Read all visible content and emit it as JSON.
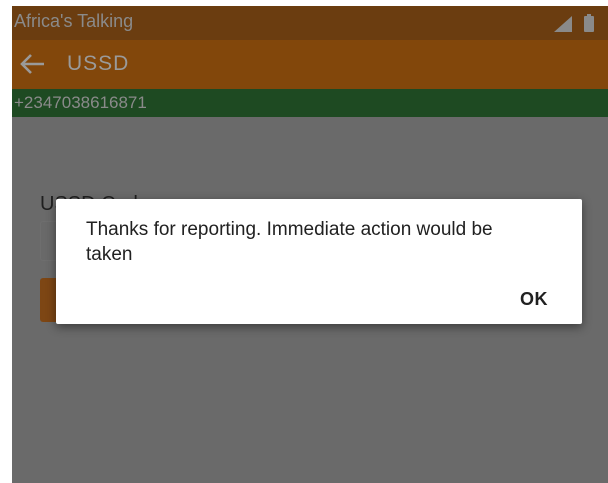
{
  "status_bar": {
    "app_name": "Africa's Talking",
    "icons": [
      "signal-icon",
      "battery-icon"
    ]
  },
  "app_bar": {
    "back_icon": "arrow-left-icon",
    "title": "USSD"
  },
  "phone_bar": {
    "number": "+2347038616871"
  },
  "form": {
    "code_label": "USSD Code",
    "code_value": "",
    "send_button_label": ""
  },
  "dialog": {
    "message": "Thanks for reporting. Immediate action would be taken",
    "ok_label": "OK"
  },
  "colors": {
    "status_bar": "#6b3d10",
    "app_bar": "#82470b",
    "phone_bar": "#1e4a22",
    "scrim_background": "#6a6a6a",
    "send_button": "#7d4614",
    "dialog_background": "#ffffff"
  }
}
